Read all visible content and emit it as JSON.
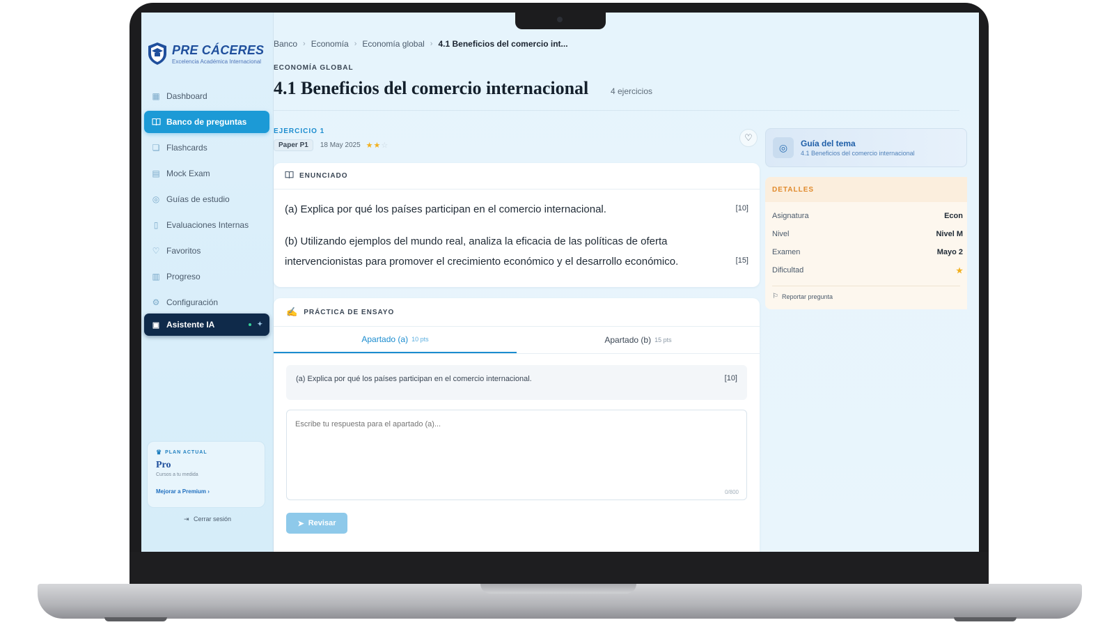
{
  "brand": {
    "name": "PRE CÁCERES",
    "tagline": "Excelencia Académica Internacional"
  },
  "sidebar": {
    "items": [
      {
        "label": "Dashboard",
        "icon": "grid-icon"
      },
      {
        "label": "Banco de preguntas",
        "icon": "book-icon",
        "active": true
      },
      {
        "label": "Flashcards",
        "icon": "cards-icon"
      },
      {
        "label": "Mock Exam",
        "icon": "clipboard-icon"
      },
      {
        "label": "Guías de estudio",
        "icon": "compass-icon"
      },
      {
        "label": "Evaluaciones Internas",
        "icon": "file-icon"
      },
      {
        "label": "Favoritos",
        "icon": "heart-icon"
      },
      {
        "label": "Progreso",
        "icon": "bar-chart-icon"
      },
      {
        "label": "Configuración",
        "icon": "gear-icon"
      }
    ],
    "assistant": {
      "label": "Asistente IA",
      "icon": "robot-icon"
    },
    "plan": {
      "label": "PLAN ACTUAL",
      "name": "Pro",
      "desc": "Cursos a tu medida",
      "upgrade": "Mejorar a Premium"
    },
    "logout": "Cerrar sesión"
  },
  "breadcrumb": [
    "Banco",
    "Economía",
    "Economía global",
    "4.1 Beneficios del comercio int..."
  ],
  "header": {
    "kicker": "ECONOMÍA GLOBAL",
    "title": "4.1 Beneficios del comercio internacional",
    "count": "4 ejercicios"
  },
  "exercise": {
    "label": "EJERCICIO 1",
    "paper": "Paper P1",
    "date": "18 May 2025",
    "difficulty_stars": 2,
    "difficulty_max": 3
  },
  "statement": {
    "title": "ENUNCIADO",
    "part_a": "(a) Explica por qué los países participan en el comercio internacional.",
    "mark_a": "[10]",
    "part_b": "(b) Utilizando ejemplos del mundo real, analiza la eficacia de las políticas de oferta intervencionistas para promover el crecimiento económico y el desarrollo económico.",
    "mark_b": "[15]"
  },
  "practice": {
    "title": "PRÁCTICA DE ENSAYO",
    "tabs": [
      {
        "label": "Apartado (a)",
        "pts": "10 pts",
        "active": true
      },
      {
        "label": "Apartado (b)",
        "pts": "15 pts",
        "active": false
      }
    ],
    "prompt": "(a) Explica por qué los países participan en el comercio internacional.",
    "prompt_mark": "[10]",
    "placeholder": "Escribe tu respuesta para el apartado (a)...",
    "counter": "0/800",
    "submit": "Revisar"
  },
  "guide": {
    "title": "Guía del tema",
    "subtitle": "4.1 Beneficios del comercio internacional"
  },
  "details": {
    "title": "DETALLES",
    "rows": [
      {
        "label": "Asignatura",
        "value": "Econ"
      },
      {
        "label": "Nivel",
        "value": "Nivel M"
      },
      {
        "label": "Examen",
        "value": "Mayo 2"
      },
      {
        "label": "Dificultad",
        "value": "★"
      }
    ],
    "report": "Reportar pregunta"
  },
  "colors": {
    "accent": "#1c9ad6",
    "brand": "#1f4f9c",
    "dark": "#0f2a4a",
    "warning": "#e08a2c",
    "star": "#f2b01e"
  }
}
